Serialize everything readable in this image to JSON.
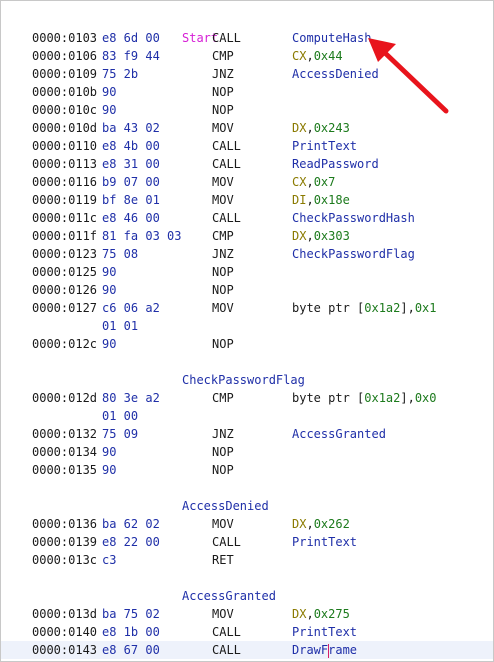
{
  "labels": {
    "start": "Start",
    "check_password_flag": "CheckPasswordFlag",
    "access_denied": "AccessDenied",
    "access_granted": "AccessGranted"
  },
  "colors": {
    "label_start": "#d61fd6",
    "symbol": "#1f2fa8",
    "register": "#8a7a00",
    "number": "#1c7a1c",
    "annotation_arrow": "#e8141c"
  },
  "annotation": {
    "type": "red-arrow",
    "points_to": "ComputeHash"
  },
  "rows": [
    {
      "addr": "0000:0103",
      "bytes": "e8 6d 00",
      "mnem": "CALL",
      "ops": [
        {
          "t": "ComputeHash",
          "c": "sym"
        }
      ]
    },
    {
      "addr": "0000:0106",
      "bytes": "83 f9 44",
      "mnem": "CMP",
      "ops": [
        {
          "t": "CX",
          "c": "reg"
        },
        {
          "t": ",",
          "c": "plain"
        },
        {
          "t": "0x44",
          "c": "num"
        }
      ]
    },
    {
      "addr": "0000:0109",
      "bytes": "75 2b",
      "mnem": "JNZ",
      "ops": [
        {
          "t": "AccessDenied",
          "c": "sym"
        }
      ]
    },
    {
      "addr": "0000:010b",
      "bytes": "90",
      "mnem": "NOP",
      "ops": []
    },
    {
      "addr": "0000:010c",
      "bytes": "90",
      "mnem": "NOP",
      "ops": []
    },
    {
      "addr": "0000:010d",
      "bytes": "ba 43 02",
      "mnem": "MOV",
      "ops": [
        {
          "t": "DX",
          "c": "reg"
        },
        {
          "t": ",",
          "c": "plain"
        },
        {
          "t": "0x243",
          "c": "num"
        }
      ]
    },
    {
      "addr": "0000:0110",
      "bytes": "e8 4b 00",
      "mnem": "CALL",
      "ops": [
        {
          "t": "PrintText",
          "c": "sym"
        }
      ]
    },
    {
      "addr": "0000:0113",
      "bytes": "e8 31 00",
      "mnem": "CALL",
      "ops": [
        {
          "t": "ReadPassword",
          "c": "sym"
        }
      ]
    },
    {
      "addr": "0000:0116",
      "bytes": "b9 07 00",
      "mnem": "MOV",
      "ops": [
        {
          "t": "CX",
          "c": "reg"
        },
        {
          "t": ",",
          "c": "plain"
        },
        {
          "t": "0x7",
          "c": "num"
        }
      ]
    },
    {
      "addr": "0000:0119",
      "bytes": "bf 8e 01",
      "mnem": "MOV",
      "ops": [
        {
          "t": "DI",
          "c": "reg"
        },
        {
          "t": ",",
          "c": "plain"
        },
        {
          "t": "0x18e",
          "c": "num"
        }
      ]
    },
    {
      "addr": "0000:011c",
      "bytes": "e8 46 00",
      "mnem": "CALL",
      "ops": [
        {
          "t": "CheckPasswordHash",
          "c": "sym"
        }
      ]
    },
    {
      "addr": "0000:011f",
      "bytes": "81 fa 03 03",
      "mnem": "CMP",
      "ops": [
        {
          "t": "DX",
          "c": "reg"
        },
        {
          "t": ",",
          "c": "plain"
        },
        {
          "t": "0x303",
          "c": "num"
        }
      ]
    },
    {
      "addr": "0000:0123",
      "bytes": "75 08",
      "mnem": "JNZ",
      "ops": [
        {
          "t": "CheckPasswordFlag",
          "c": "sym"
        }
      ]
    },
    {
      "addr": "0000:0125",
      "bytes": "90",
      "mnem": "NOP",
      "ops": []
    },
    {
      "addr": "0000:0126",
      "bytes": "90",
      "mnem": "NOP",
      "ops": []
    },
    {
      "addr": "0000:0127",
      "bytes": "c6 06 a2",
      "mnem": "MOV",
      "ops": [
        {
          "t": "byte ptr [",
          "c": "plain"
        },
        {
          "t": "0x1a2",
          "c": "num"
        },
        {
          "t": "],",
          "c": "plain"
        },
        {
          "t": "0x1",
          "c": "num"
        }
      ]
    },
    {
      "addr": "",
      "bytes": "01 01",
      "mnem": "",
      "ops": []
    },
    {
      "addr": "0000:012c",
      "bytes": "90",
      "mnem": "NOP",
      "ops": []
    },
    {
      "blank": true
    },
    {
      "label": "check_password_flag"
    },
    {
      "addr": "0000:012d",
      "bytes": "80 3e a2",
      "mnem": "CMP",
      "ops": [
        {
          "t": "byte ptr [",
          "c": "plain"
        },
        {
          "t": "0x1a2",
          "c": "num"
        },
        {
          "t": "],",
          "c": "plain"
        },
        {
          "t": "0x0",
          "c": "num"
        }
      ]
    },
    {
      "addr": "",
      "bytes": "01 00",
      "mnem": "",
      "ops": []
    },
    {
      "addr": "0000:0132",
      "bytes": "75 09",
      "mnem": "JNZ",
      "ops": [
        {
          "t": "AccessGranted",
          "c": "sym"
        }
      ]
    },
    {
      "addr": "0000:0134",
      "bytes": "90",
      "mnem": "NOP",
      "ops": []
    },
    {
      "addr": "0000:0135",
      "bytes": "90",
      "mnem": "NOP",
      "ops": []
    },
    {
      "blank": true
    },
    {
      "label": "access_denied"
    },
    {
      "addr": "0000:0136",
      "bytes": "ba 62 02",
      "mnem": "MOV",
      "ops": [
        {
          "t": "DX",
          "c": "reg"
        },
        {
          "t": ",",
          "c": "plain"
        },
        {
          "t": "0x262",
          "c": "num"
        }
      ]
    },
    {
      "addr": "0000:0139",
      "bytes": "e8 22 00",
      "mnem": "CALL",
      "ops": [
        {
          "t": "PrintText",
          "c": "sym"
        }
      ]
    },
    {
      "addr": "0000:013c",
      "bytes": "c3",
      "mnem": "RET",
      "ops": []
    },
    {
      "blank": true
    },
    {
      "label": "access_granted"
    },
    {
      "addr": "0000:013d",
      "bytes": "ba 75 02",
      "mnem": "MOV",
      "ops": [
        {
          "t": "DX",
          "c": "reg"
        },
        {
          "t": ",",
          "c": "plain"
        },
        {
          "t": "0x275",
          "c": "num"
        }
      ]
    },
    {
      "addr": "0000:0140",
      "bytes": "e8 1b 00",
      "mnem": "CALL",
      "ops": [
        {
          "t": "PrintText",
          "c": "sym"
        }
      ]
    },
    {
      "addr": "0000:0143",
      "bytes": "e8 67 00",
      "mnem": "CALL",
      "ops": [
        {
          "t": "DrawFrame",
          "c": "sym"
        }
      ],
      "current": true
    }
  ]
}
